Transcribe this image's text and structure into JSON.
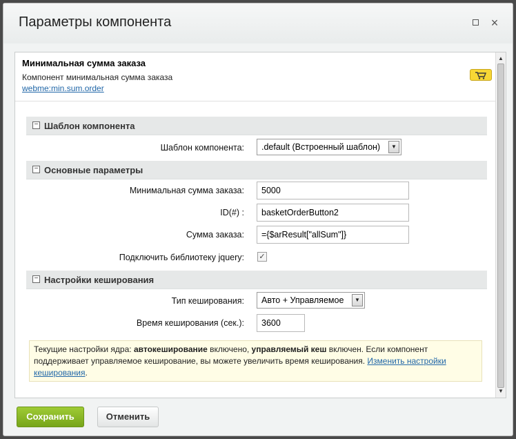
{
  "dialog": {
    "title": "Параметры компонента",
    "maximize_icon": "maximize-icon",
    "close_label": "×"
  },
  "component": {
    "name": "Минимальная сумма заказа",
    "description": "Компонент минимальная сумма заказа",
    "code": "webme:min.sum.order",
    "badge_icon": "cart-icon"
  },
  "sections": [
    {
      "title": "Шаблон компонента",
      "toggle": "−"
    },
    {
      "title": "Основные параметры",
      "toggle": "−"
    },
    {
      "title": "Настройки кеширования",
      "toggle": "−"
    }
  ],
  "template_section": {
    "template_label": "Шаблон компонента:",
    "template_value": ".default (Встроенный шаблон)"
  },
  "main_section": {
    "min_sum_label": "Минимальная сумма заказа:",
    "min_sum_value": "5000",
    "id_label": "ID(#) :",
    "id_value": "basketOrderButton2",
    "order_sum_label": "Сумма заказа:",
    "order_sum_value": "={$arResult[\"allSum\"]}",
    "jquery_label": "Подключить библиотеку jquery:",
    "jquery_checked": "✓"
  },
  "cache_section": {
    "cache_type_label": "Тип кеширования:",
    "cache_type_value": "Авто + Управляемое",
    "cache_time_label": "Время кеширования (сек.):",
    "cache_time_value": "3600"
  },
  "note": {
    "part1": "Текущие настройки ядра: ",
    "bold1": "автокеширование",
    "part2": " включено, ",
    "bold2": "управляемый кеш",
    "part3": " включен. Если компонент поддерживает управляемое кеширование, вы можете увеличить время кеширования. ",
    "link": "Изменить настройки кеширования",
    "part4": "."
  },
  "buttons": {
    "save": "Сохранить",
    "cancel": "Отменить"
  },
  "colors": {
    "save_button": "#8cb82a",
    "link": "#2167a8",
    "note_bg": "#fffde6",
    "badge": "#f7d735"
  }
}
